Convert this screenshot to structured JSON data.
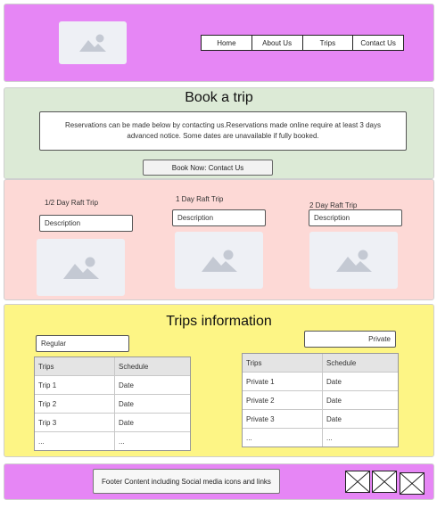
{
  "header": {
    "logo_icon": "image-placeholder-icon",
    "nav": [
      "Home",
      "About Us",
      "Trips",
      "Contact Us"
    ]
  },
  "book": {
    "title": "Book a trip",
    "notice": "Reservations can be made below by contacting us.Reservations made online require at least 3 days advanced notice. Some dates are unavailable if fully booked.",
    "button": "Book Now: Contact Us"
  },
  "trips": [
    {
      "label": "1/2 Day Raft Trip",
      "description": "Description",
      "image_icon": "image-placeholder-icon"
    },
    {
      "label": "1 Day Raft Trip",
      "description": "Description",
      "image_icon": "image-placeholder-icon"
    },
    {
      "label": "2 Day Raft Trip",
      "description": "Description",
      "image_icon": "image-placeholder-icon"
    }
  ],
  "info": {
    "title": "Trips information",
    "regular": {
      "label": "Regular",
      "headers": [
        "Trips",
        "Schedule"
      ],
      "rows": [
        [
          "Trip 1",
          "Date"
        ],
        [
          "Trip 2",
          "Date"
        ],
        [
          "Trip 3",
          "Date"
        ],
        [
          "...",
          "..."
        ]
      ]
    },
    "private": {
      "label": "Private",
      "headers": [
        "Trips",
        "Schedule"
      ],
      "rows": [
        [
          "Private 1",
          "Date"
        ],
        [
          "Private 2",
          "Date"
        ],
        [
          "Private 3",
          "Date"
        ],
        [
          "...",
          "..."
        ]
      ]
    }
  },
  "footer": {
    "text": "Footer Content including Social media icons and links",
    "social_icons": [
      "social-icon",
      "social-icon",
      "social-icon"
    ]
  },
  "colors": {
    "header_bg": "#e686f5",
    "book_bg": "#dcead6",
    "trips_bg": "#fdd9d6",
    "info_bg": "#fdf585",
    "footer_bg": "#e686f5",
    "placeholder_bg": "#eef0f5",
    "placeholder_fg": "#c4c9d3"
  }
}
